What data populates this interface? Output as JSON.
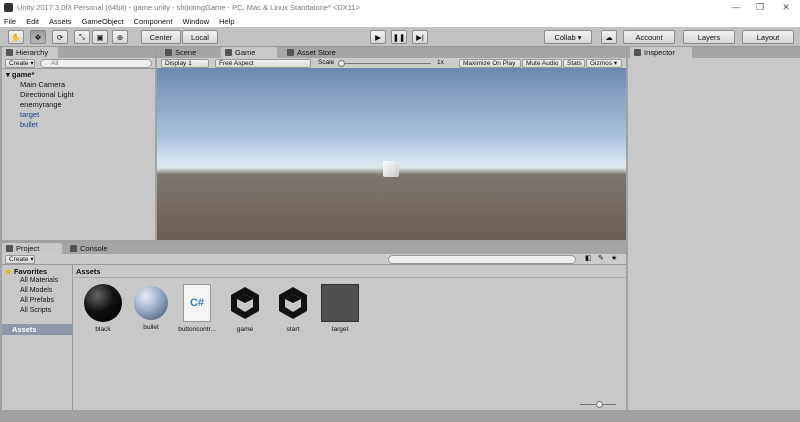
{
  "window": {
    "title": "Unity 2017.3.0f3 Personal (64bit) - game.unity - shootingGame - PC, Mac & Linux Standalone* <DX11>",
    "minimize": "—",
    "maximize": "❐",
    "close": "✕"
  },
  "menu": [
    "File",
    "Edit",
    "Assets",
    "GameObject",
    "Component",
    "Window",
    "Help"
  ],
  "toolbar": {
    "center": "Center",
    "local": "Local",
    "collab": "Collab ▾",
    "account": "Account",
    "layers": "Layers",
    "layout": "Layout"
  },
  "hierarchy": {
    "tab": "Hierarchy",
    "create": "Create ▾",
    "search_placeholder": "All",
    "scene": "game*",
    "items": [
      "Main Camera",
      "Directional Light",
      "enemyrange",
      "target",
      "bullet"
    ]
  },
  "center_tabs": [
    "Scene",
    "Game",
    "Asset Store"
  ],
  "game_bar": {
    "display": "Display 1",
    "aspect": "Free Aspect",
    "scale_label": "Scale",
    "scale_value": "1x",
    "maximize": "Maximize On Play",
    "mute": "Mute Audio",
    "stats": "Stats",
    "gizmos": "Gizmos ▾"
  },
  "inspector": {
    "tab": "Inspector"
  },
  "project": {
    "tab": "Project",
    "console_tab": "Console",
    "create": "Create ▾",
    "favorites": "Favorites",
    "fav_items": [
      "All Materials",
      "All Models",
      "All Prefabs",
      "All Scripts"
    ],
    "assets_root": "Assets",
    "breadcrumb": "Assets",
    "assets": [
      {
        "name": "black",
        "kind": "sphere-black"
      },
      {
        "name": "bullet",
        "kind": "sphere-light"
      },
      {
        "name": "buttoncontr...",
        "kind": "script"
      },
      {
        "name": "game",
        "kind": "unity"
      },
      {
        "name": "start",
        "kind": "unity"
      },
      {
        "name": "target",
        "kind": "prefab"
      }
    ]
  }
}
